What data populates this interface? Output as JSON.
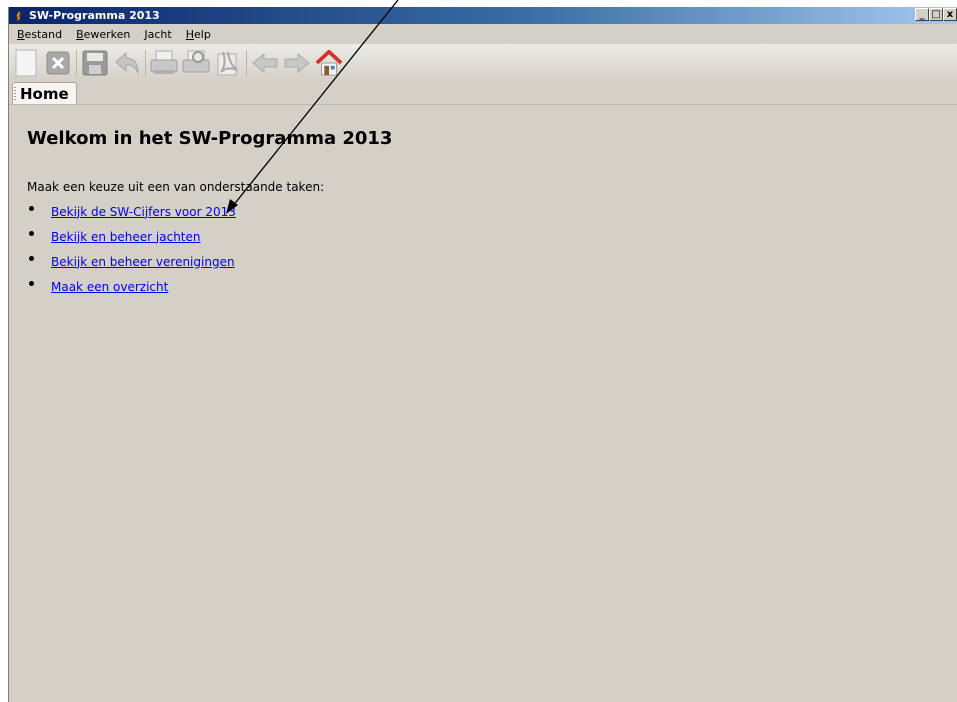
{
  "window": {
    "title": "SW-Programma 2013",
    "controls": {
      "minimize": "_",
      "maximize": "□",
      "close": "x"
    }
  },
  "menu": [
    {
      "label": "Bestand",
      "mnemonic": "B",
      "rest": "estand"
    },
    {
      "label": "Bewerken",
      "mnemonic": "B",
      "rest": "ewerken"
    },
    {
      "label": "Jacht",
      "mnemonic": "",
      "rest": "Jacht"
    },
    {
      "label": "Help",
      "mnemonic": "H",
      "rest": "elp"
    }
  ],
  "toolbar": {
    "icons": [
      "new-document-icon",
      "delete-icon",
      "save-icon",
      "undo-icon",
      "print-icon",
      "print-preview-icon",
      "pdf-export-icon",
      "back-arrow-icon",
      "forward-arrow-icon",
      "home-icon"
    ]
  },
  "tab": {
    "label": "Home"
  },
  "main": {
    "title": "Welkom in het SW-Programma 2013",
    "intro": "Maak een keuze uit een van onderstaande taken:",
    "tasks": [
      {
        "label": "Bekijk de SW-Cijfers voor 2013"
      },
      {
        "label": "Bekijk en beheer jachten"
      },
      {
        "label": "Bekijk en beheer verenigingen"
      },
      {
        "label": "Maak een overzicht"
      }
    ]
  },
  "colors": {
    "accent_title": "#0a246a",
    "link": "#0000ee",
    "window_bg": "#d4d0c8"
  }
}
